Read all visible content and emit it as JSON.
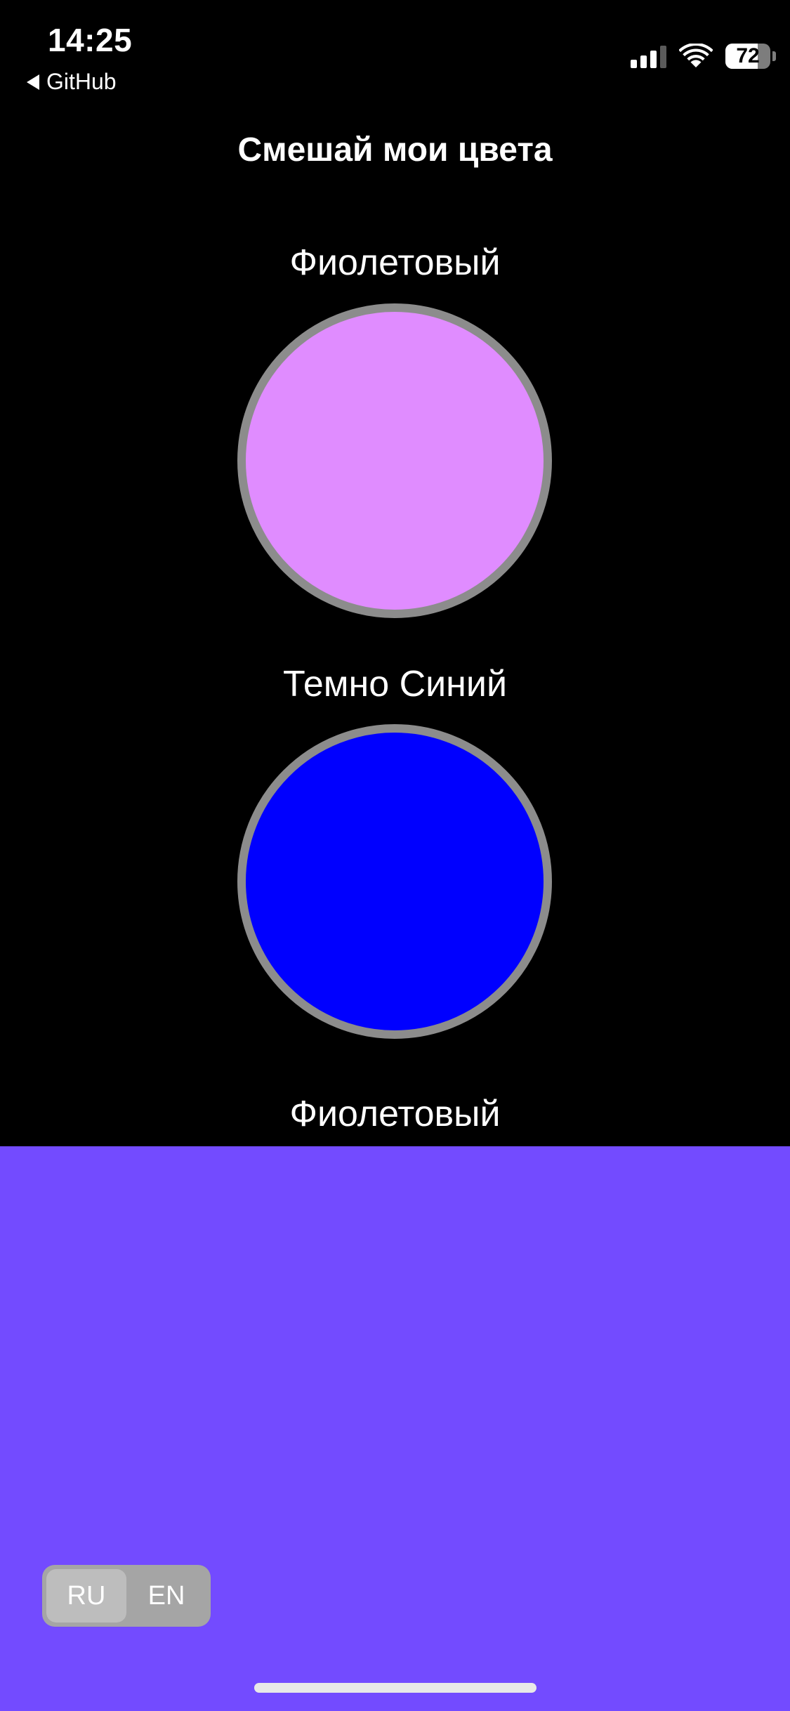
{
  "status_bar": {
    "time": "14:25",
    "back_label": "GitHub",
    "battery": "72",
    "icons": [
      "back-arrow-icon",
      "cellular-signal-icon",
      "wifi-icon",
      "battery-icon"
    ]
  },
  "title": "Смешай мои цвета",
  "colors": [
    {
      "label": "Фиолетовый",
      "color": "#e08cff"
    },
    {
      "label": "Темно Синий",
      "color": "#0000ff"
    }
  ],
  "result": {
    "label": "Фиолетовый",
    "color": "#734bff"
  },
  "language_toggle": {
    "options": [
      "RU",
      "EN"
    ],
    "selected": "RU"
  },
  "theme": {
    "background": "#000000",
    "circle_border": "#8c8c8c",
    "toggle_bg": "#a5a5a5",
    "toggle_active": "#bdbdbd"
  }
}
